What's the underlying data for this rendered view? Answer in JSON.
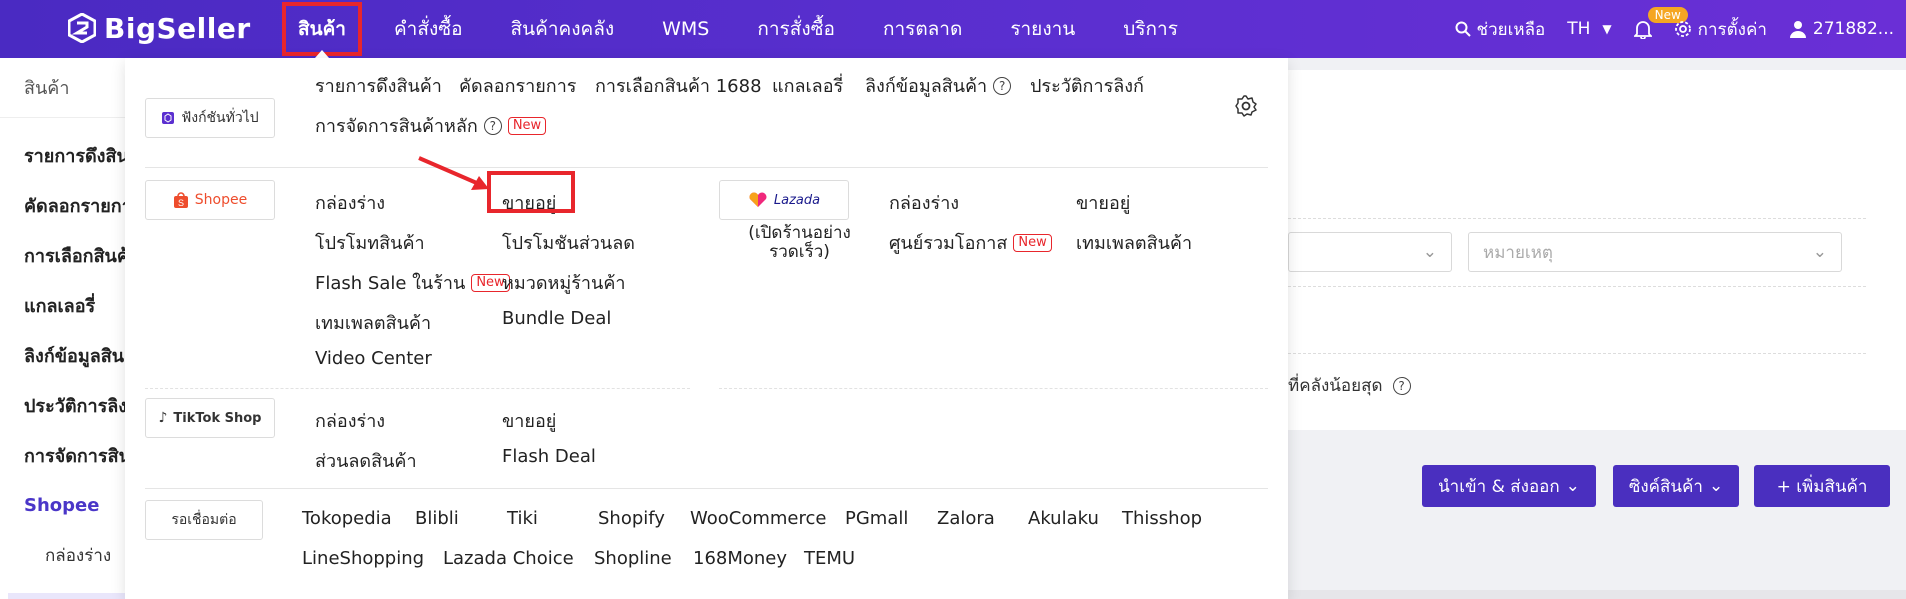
{
  "brand": {
    "name": "BigSeller"
  },
  "nav": {
    "items": [
      "สินค้า",
      "คำสั่งซื้อ",
      "สินค้าคงคลัง",
      "WMS",
      "การสั่งซื้อ",
      "การตลาด",
      "รายงาน",
      "บริการ"
    ],
    "active": "สินค้า"
  },
  "top_right": {
    "help": "ช่วยเหลือ",
    "lang": "TH",
    "new_badge": "New",
    "settings": "การตั้งค่า",
    "user": "271882..."
  },
  "sidebar": {
    "header": "สินค้า",
    "items": [
      "รายการดึงสินค้า",
      "คัดลอกรายการ",
      "การเลือกสินค้า",
      "แกลเลอรี่",
      "ลิงก์ข้อมูลสินค้า",
      "ประวัติการลิงก์",
      "การจัดการสินค้า",
      "Shopee"
    ],
    "sub_items": [
      "กล่องร่าง"
    ]
  },
  "background": {
    "note_placeholder": "หมายเหตุ",
    "min_stock_label": "ที่คลังน้อยสุด",
    "buttons": {
      "import_export": "นำเข้า & ส่งออก",
      "sync": "ซิงค์สินค้า",
      "add": "+ เพิ่มสินค้า"
    }
  },
  "dropdown": {
    "general": {
      "label": "ฟังก์ชันทั่วไป",
      "links": [
        "รายการดึงสินค้า",
        "คัดลอกรายการ",
        "การเลือกสินค้า 1688",
        "แกลเลอรี่",
        "ลิงก์ข้อมูลสินค้า",
        "ประวัติการลิงก์",
        "การจัดการสินค้าหลัก"
      ],
      "new_tag": "New"
    },
    "shopee": {
      "label": "Shopee",
      "links": [
        "กล่องร่าง",
        "ขายอยู่",
        "โปรโมทสินค้า",
        "โปรโมชันส่วนลด",
        "Flash Sale ในร้าน",
        "หมวดหมู่ร้านค้า",
        "เทมเพลตสินค้า",
        "Bundle Deal",
        "Video Center"
      ],
      "new_tag": "New"
    },
    "lazada": {
      "label": "Lazada",
      "sub_label": "(เปิดร้านอย่างรวดเร็ว)",
      "links": [
        "กล่องร่าง",
        "ขายอยู่",
        "ศูนย์รวมโอกาส",
        "เทมเพลตสินค้า"
      ],
      "new_tag": "New"
    },
    "tiktok": {
      "label": "TikTok Shop",
      "links": [
        "กล่องร่าง",
        "ขายอยู่",
        "ส่วนลดสินค้า",
        "Flash Deal"
      ]
    },
    "pending": {
      "label": "รอเชื่อมต่อ",
      "platforms": [
        "Tokopedia",
        "Blibli",
        "Tiki",
        "Shopify",
        "WooCommerce",
        "PGmall",
        "Zalora",
        "Akulaku",
        "Thisshop",
        "LineShopping",
        "Lazada Choice",
        "Shopline",
        "168Money",
        "TEMU"
      ]
    }
  },
  "colors": {
    "brand_purple": "#5b2fd0",
    "highlight_red": "#e8262c",
    "shopee_orange": "#ee4d2d",
    "accent": "#4a36c8"
  }
}
